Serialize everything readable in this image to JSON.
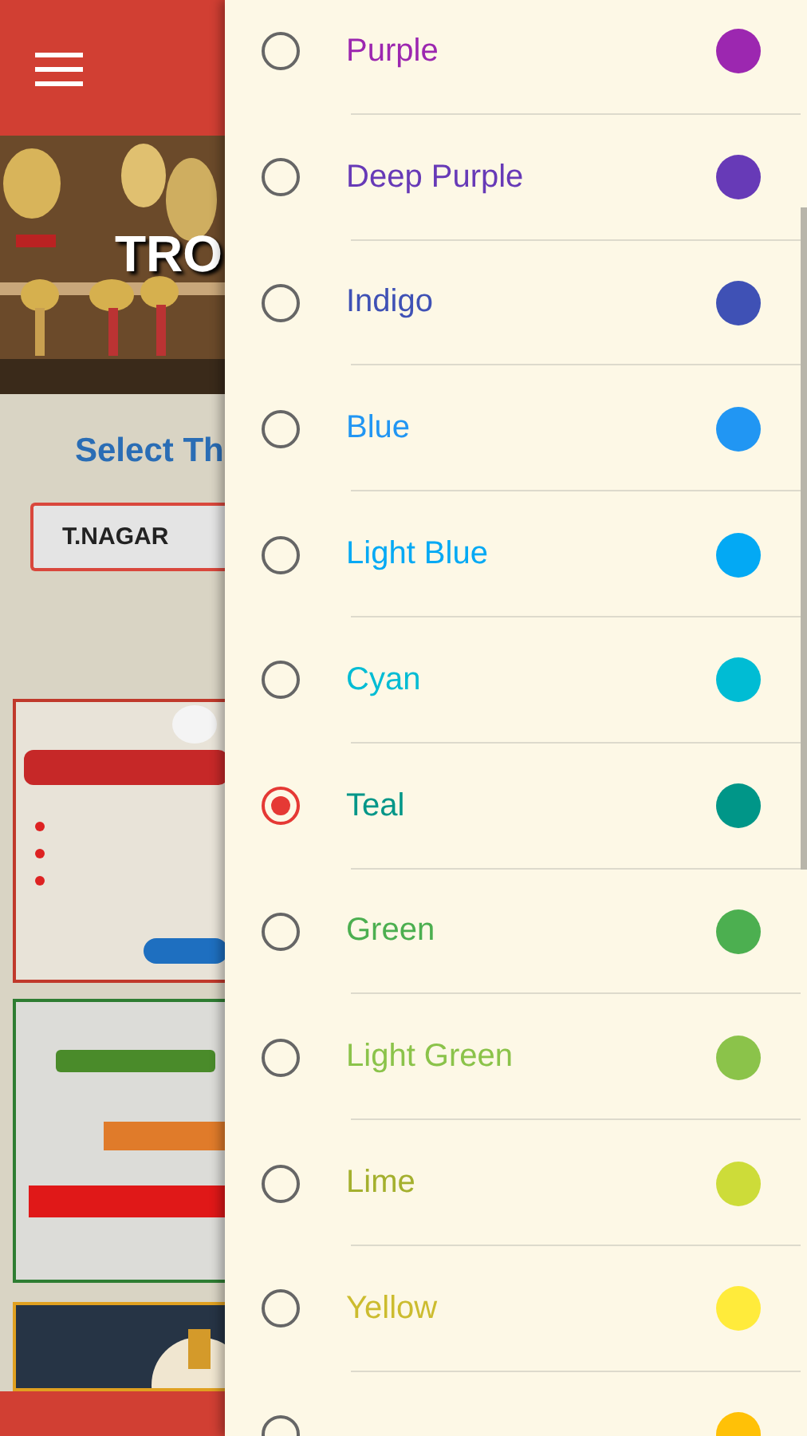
{
  "page": {
    "banner_title": "TRO",
    "section_title": "Select Th",
    "branch_field": {
      "value": "T.NAGAR"
    }
  },
  "color_picker": {
    "items": [
      {
        "label": "Purple",
        "color": "#9c27b0",
        "selected": false
      },
      {
        "label": "Deep Purple",
        "color": "#673ab7",
        "selected": false
      },
      {
        "label": "Indigo",
        "color": "#3f51b5",
        "selected": false
      },
      {
        "label": "Blue",
        "color": "#2196f3",
        "selected": false
      },
      {
        "label": "Light Blue",
        "color": "#03a9f4",
        "selected": false
      },
      {
        "label": "Cyan",
        "color": "#00bcd4",
        "selected": false
      },
      {
        "label": "Teal",
        "color": "#009688",
        "selected": true
      },
      {
        "label": "Green",
        "color": "#4caf50",
        "selected": false
      },
      {
        "label": "Light Green",
        "color": "#8bc34a",
        "selected": false
      },
      {
        "label": "Lime",
        "color": "#cddc39",
        "selected": false
      },
      {
        "label": "Yellow",
        "color": "#ffeb3b",
        "selected": false
      },
      {
        "color": "#ffc107",
        "selected": false
      }
    ]
  }
}
